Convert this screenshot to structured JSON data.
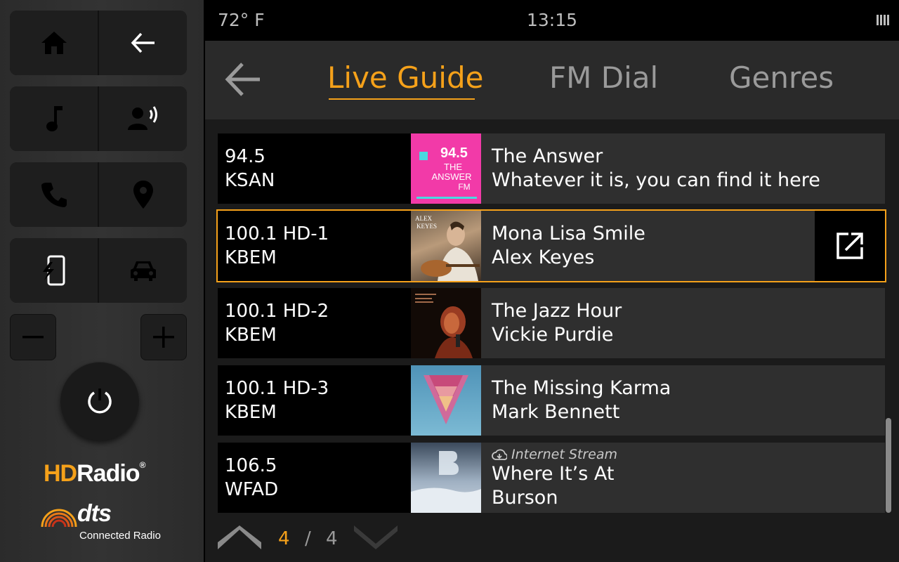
{
  "status": {
    "temperature": "72° F",
    "time": "13:15"
  },
  "tabs": [
    {
      "label": "Live Guide",
      "active": true
    },
    {
      "label": "FM Dial",
      "active": false
    },
    {
      "label": "Genres",
      "active": false
    }
  ],
  "stations": [
    {
      "frequency": "94.5",
      "callsign": "KSAN",
      "title": "The Answer",
      "subtitle": "Whatever it is, you can find it here",
      "art": "the-answer-logo",
      "art_text": [
        "94.5",
        "THE",
        "ANSWER",
        "FM"
      ]
    },
    {
      "frequency": "100.1 HD-1",
      "callsign": "KBEM",
      "title": "Mona Lisa Smile",
      "subtitle": "Alex Keyes",
      "art": "alex-keyes-album",
      "art_text": [
        "ALEX",
        "KEYES"
      ],
      "selected": true
    },
    {
      "frequency": "100.1 HD-2",
      "callsign": "KBEM",
      "title": "The Jazz Hour",
      "subtitle": "Vickie Purdie",
      "art": "vickie-purdie-album"
    },
    {
      "frequency": "100.1 HD-3",
      "callsign": "KBEM",
      "title": "The Missing Karma",
      "subtitle": "Mark Bennett",
      "art": "triangle-album"
    },
    {
      "frequency": "106.5",
      "callsign": "WFAD",
      "note": "Internet Stream",
      "title": "Where It’s At",
      "subtitle": "Burson",
      "art": "burson-album"
    }
  ],
  "pager": {
    "current": "4",
    "separator": "/",
    "total": "4"
  },
  "branding": {
    "hd_radio": "Radio",
    "hd_mark": "HD",
    "reg": "®",
    "dts": "dts",
    "dts_reg": "®",
    "connected": "Connected Radio"
  },
  "colors": {
    "accent": "#f5a11a",
    "panel": "#2b2b2b",
    "row": "#2f2f2f"
  }
}
